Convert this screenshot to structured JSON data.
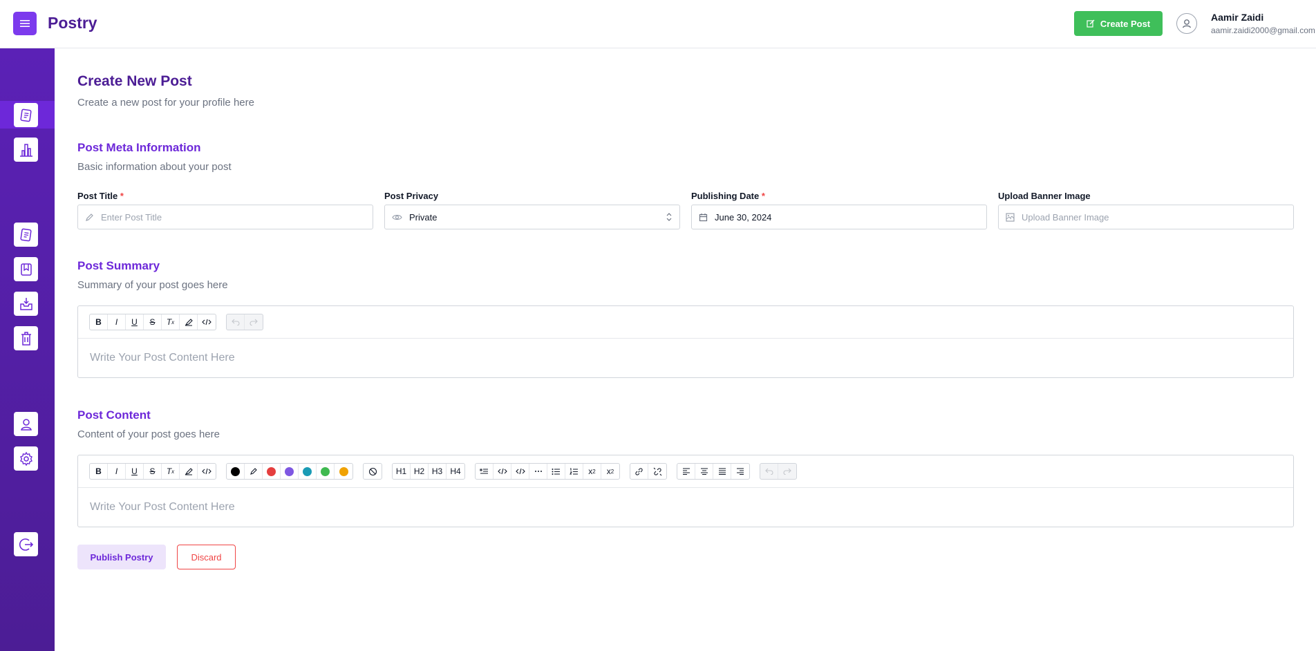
{
  "header": {
    "brand": "Postry",
    "create_post_label": "Create Post",
    "user_name": "Aamir Zaidi",
    "user_email": "aamir.zaidi2000@gmail.com"
  },
  "sidebar": {
    "items": [
      "posts",
      "analytics",
      "drafts",
      "bookmarks",
      "archive",
      "trash",
      "profile",
      "settings",
      "logout"
    ],
    "active": "posts"
  },
  "page": {
    "title": "Create New Post",
    "subtitle": "Create a new post for your profile here"
  },
  "meta": {
    "title": "Post Meta Information",
    "subtitle": "Basic information about your post",
    "post_title_label": "Post Title",
    "post_title_placeholder": "Enter Post Title",
    "privacy_label": "Post Privacy",
    "privacy_value": "Private",
    "date_label": "Publishing Date",
    "date_value": "June 30, 2024",
    "banner_label": "Upload Banner Image",
    "banner_placeholder": "Upload Banner Image",
    "required_mark": "*"
  },
  "summary": {
    "title": "Post Summary",
    "subtitle": "Summary of your post goes here",
    "placeholder": "Write Your Post Content Here"
  },
  "content": {
    "title": "Post Content",
    "subtitle": "Content of your post goes here",
    "placeholder": "Write Your Post Content Here",
    "colors": [
      "#000000",
      "#e53e3e",
      "#7e57e2",
      "#1a9bb5",
      "#3fb950",
      "#f0a202"
    ],
    "headings": [
      "H1",
      "H2",
      "H3",
      "H4"
    ]
  },
  "actions": {
    "publish_label": "Publish Postry",
    "discard_label": "Discard"
  },
  "colors": {
    "primary": "#7c3aed",
    "sidebar": "#5b21b6",
    "success": "#3fbf5a",
    "danger": "#ef4444"
  }
}
